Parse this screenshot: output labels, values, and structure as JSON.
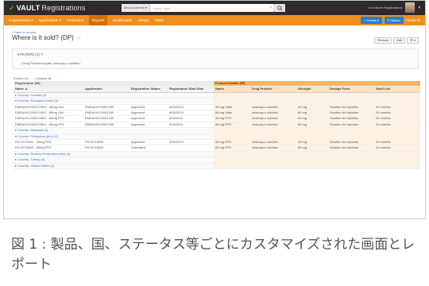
{
  "app": {
    "brand_mark": "✓",
    "brand": "VAULT",
    "title": "Registrations"
  },
  "search": {
    "scope": "All Documents ▾",
    "placeholder": "Search Vault",
    "clear": "×"
  },
  "user": {
    "name": "Ann Marie Registrations",
    "caret": "▾"
  },
  "nav": {
    "items": [
      "Registrations ▾",
      "Applications ▾",
      "Products ▾",
      "Reports",
      "Dashboards",
      "Library",
      "Tasks"
    ],
    "active_index": 3,
    "create": "+ Create ▾",
    "upload": "⤒ Upload",
    "settings": "Admin ⚙"
  },
  "report": {
    "back": "« Back to reports",
    "title": "Where is it sold? (DP)",
    "star": "☆",
    "buttons": [
      "Refresh",
      "Edit",
      "⚙ ▾"
    ]
  },
  "filters": {
    "heading": "FILTERS (1)",
    "toggle": "▾",
    "edit_icon": "✎",
    "rule": "• Drug Product equals \"zivtocap-x solution\""
  },
  "expand": {
    "expand_all": "Expand all",
    "collapse_all": "Collapse all"
  },
  "table": {
    "group_left": "Registration (58)",
    "group_right": "Product Details (58)",
    "headers": [
      "Name ▲",
      "Application",
      "Registration Status",
      "Registration Start Date",
      "Name",
      "Drug Product",
      "Strength",
      "Dosage Form",
      "Shelf Life"
    ],
    "rows": [
      {
        "kind": "country",
        "cells": [
          "▸ Country: Canada (4)"
        ]
      },
      {
        "kind": "country",
        "cells": [
          "▾ Country: European Union (4)"
        ]
      },
      {
        "kind": "data",
        "cells": [
          "EMEA/H/C/0001789/1 - 40mg Vial",
          "EMEA/H/C/0001789",
          "Approved",
          "8/15/2013",
          "40 mg Vials",
          "zivtocap-x solution",
          "40 mg",
          "Solution for Injection",
          "24 months"
        ]
      },
      {
        "kind": "data",
        "cells": [
          "EMEA/H/C/0001789/2 - 80mg Vial",
          "EMEA/H/C/0001789",
          "Approved",
          "8/15/2013",
          "80 mg Vials",
          "zivtocap-x solution",
          "80 mg",
          "Solution for Injection",
          "24 months"
        ]
      },
      {
        "kind": "data",
        "cells": [
          "EMEA/H/C/0001789/3 - 40mg PFS",
          "EMEA/H/C/0001789",
          "Approved",
          "3/20/2011",
          "40 mg PFS",
          "zivtocap-x solution",
          "40 mg",
          "Solution for Injection",
          "24 months"
        ]
      },
      {
        "kind": "data",
        "cells": [
          "EMEA/H/C/0001789/4 - 80mg PFS",
          "EMEA/H/C/0001789",
          "Approved",
          "3/20/2011",
          "80 mg PFS",
          "zivtocap-x solution",
          "80 mg",
          "Solution for Injection",
          "24 months"
        ]
      },
      {
        "kind": "country",
        "cells": [
          "▸ Country: Malaysia (4)"
        ]
      },
      {
        "kind": "country",
        "cells": [
          "▾ Country: Philippines (the) (2)"
        ]
      },
      {
        "kind": "data",
        "cells": [
          "PH-ST23402 - 40mg PFS",
          "PH-ST23402",
          "Approved",
          "4/30/2013",
          "40 mg PFS",
          "zivtocap-x solution",
          "40 mg",
          "Solution for Injection",
          "24 months"
        ]
      },
      {
        "kind": "data",
        "cells": [
          "PH-ST23402 - 80mg PFS",
          "PH-ST23402",
          "Submitted",
          "",
          "80 mg PFS",
          "zivtocap-x solution",
          "80 mg",
          "Solution for Injection",
          "24 months"
        ]
      },
      {
        "kind": "country",
        "cells": [
          "▸ Country: Russian Federation (the) (4)"
        ]
      },
      {
        "kind": "country",
        "cells": [
          "▸ Country: Turkey (4)"
        ]
      },
      {
        "kind": "country",
        "cells": [
          "▸ Country: United States (4)"
        ]
      }
    ]
  },
  "caption": {
    "text": "図 1 : 製品、国、ステータス等ごとにカスタマイズされた画面とレポート"
  }
}
